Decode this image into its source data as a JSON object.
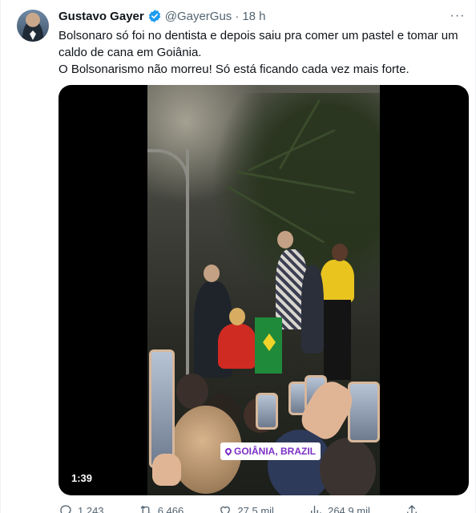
{
  "tweet": {
    "author_name": "Gustavo Gayer",
    "handle": "@GayerGus",
    "separator": "·",
    "time": "18 h",
    "more": "···",
    "text_line1": "Bolsonaro só foi no dentista e depois saiu pra comer um pastel e tomar um caldo de cana em Goiânia.",
    "text_line2": "O Bolsonarismo não morreu! Só está ficando cada vez mais forte."
  },
  "media": {
    "location_label": "GOIÂNIA, BRAZIL",
    "duration": "1:39"
  },
  "actions": [
    {
      "name": "reply",
      "icon": "reply-icon",
      "count": "1.243"
    },
    {
      "name": "retweet",
      "icon": "retweet-icon",
      "count": "6.466"
    },
    {
      "name": "like",
      "icon": "heart-icon",
      "count": "27,5 mil"
    },
    {
      "name": "views",
      "icon": "views-icon",
      "count": "264,9 mil"
    },
    {
      "name": "share",
      "icon": "share-icon",
      "count": ""
    }
  ],
  "colors": {
    "verified": "#1d9bf0",
    "text": "#0f1419",
    "secondary": "#536471",
    "location_text": "#7b2fc5"
  }
}
